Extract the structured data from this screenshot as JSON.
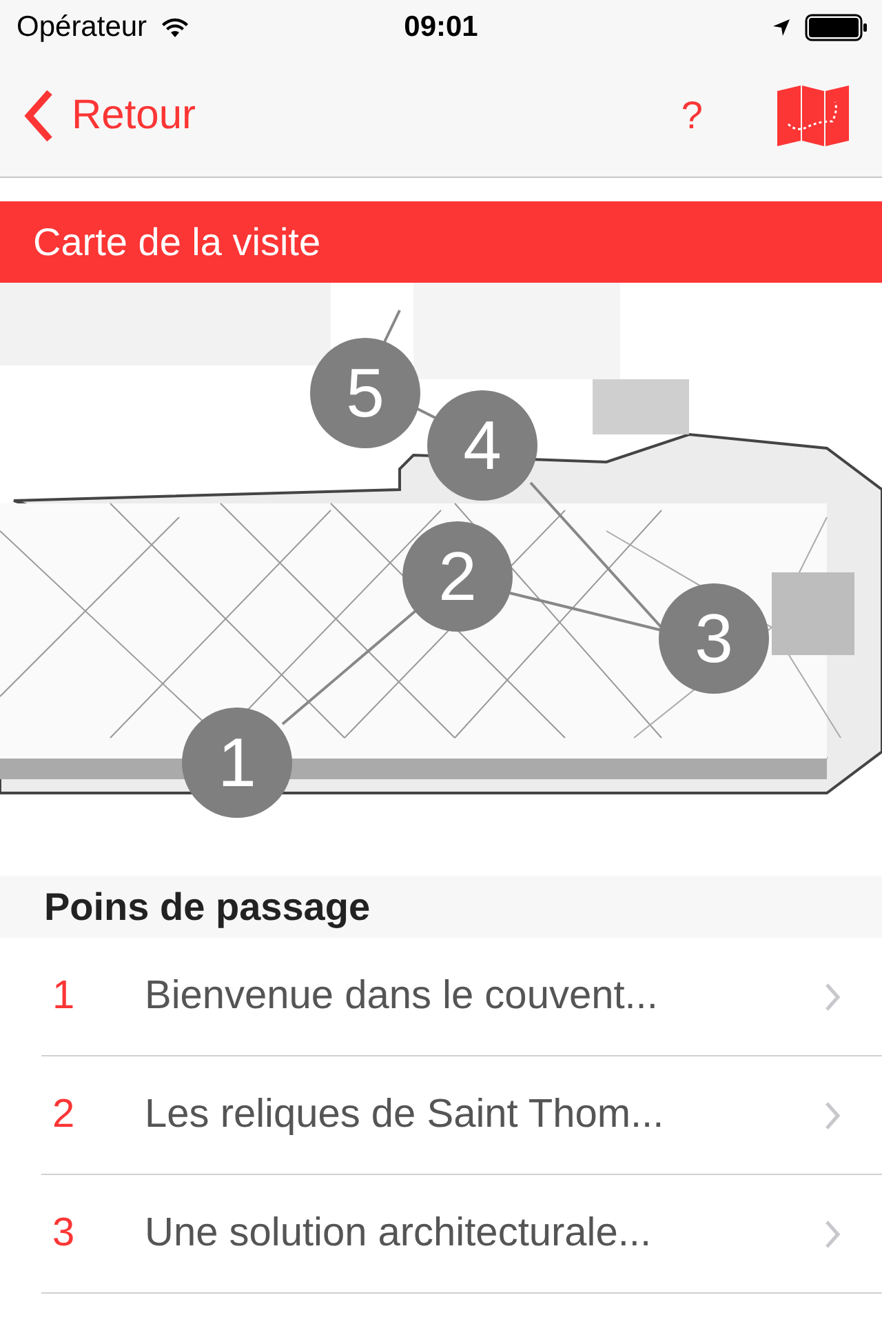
{
  "status_bar": {
    "carrier": "Opérateur",
    "time": "09:01"
  },
  "nav": {
    "back": "Retour",
    "help": "?"
  },
  "banner": {
    "title": "Carte de la visite"
  },
  "map": {
    "markers": [
      "1",
      "2",
      "3",
      "4",
      "5"
    ]
  },
  "section": {
    "title": "Poins de passage"
  },
  "stops": [
    {
      "number": "1",
      "title": "Bienvenue dans le couvent..."
    },
    {
      "number": "2",
      "title": "Les reliques de Saint Thom..."
    },
    {
      "number": "3",
      "title": "Une solution architecturale..."
    }
  ]
}
